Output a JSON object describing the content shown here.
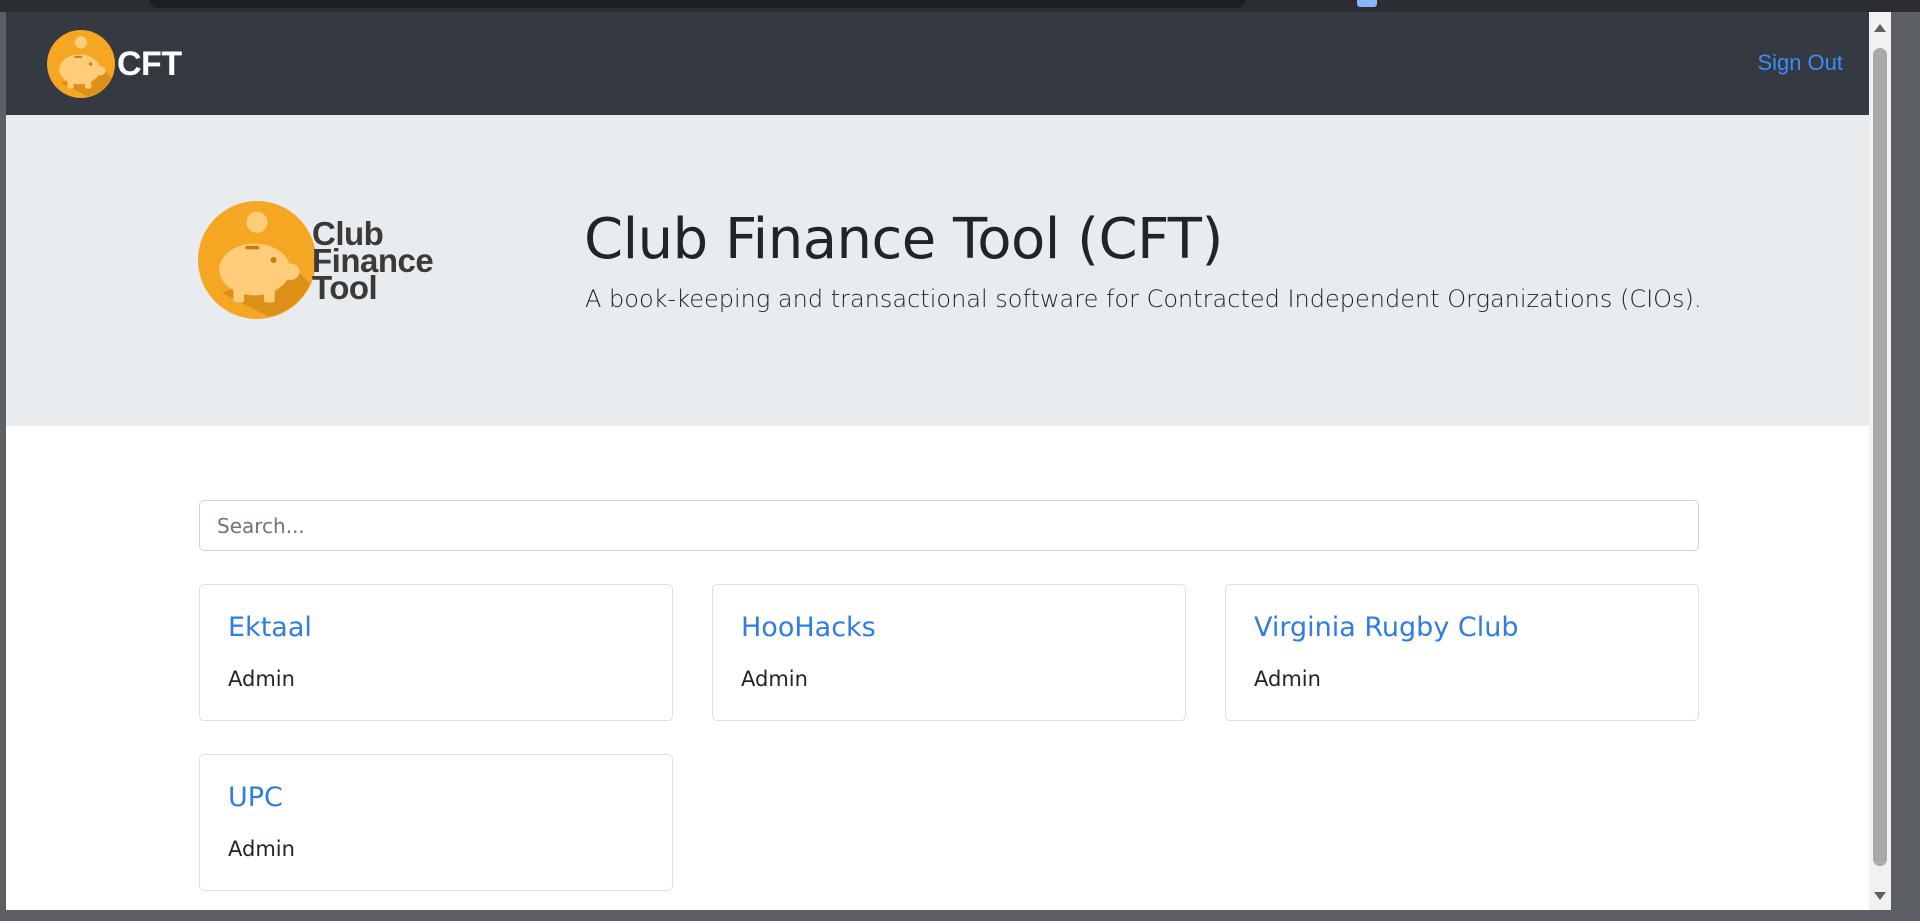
{
  "app": {
    "brand_name": "CFT",
    "colors": {
      "navbar": "#343a40",
      "hero": "#e9ecef",
      "link": "#3d8bfd",
      "logo_orange": "#f5a623",
      "logo_pig": "#ffcc7a"
    }
  },
  "navbar": {
    "logo_icon": "piggy-bank-icon",
    "signout_label": "Sign Out"
  },
  "hero": {
    "logo_lines": [
      "Club",
      "Finance",
      "Tool"
    ],
    "title": "Club Finance Tool (CFT)",
    "subtitle": "A book-keeping and transactional software for Contracted Independent Organizations (CIOs)."
  },
  "search": {
    "placeholder": "Search...",
    "value": ""
  },
  "clubs": [
    {
      "name": "Ektaal",
      "role": "Admin"
    },
    {
      "name": "HooHacks",
      "role": "Admin"
    },
    {
      "name": "Virginia Rugby Club",
      "role": "Admin"
    },
    {
      "name": "UPC",
      "role": "Admin"
    }
  ]
}
